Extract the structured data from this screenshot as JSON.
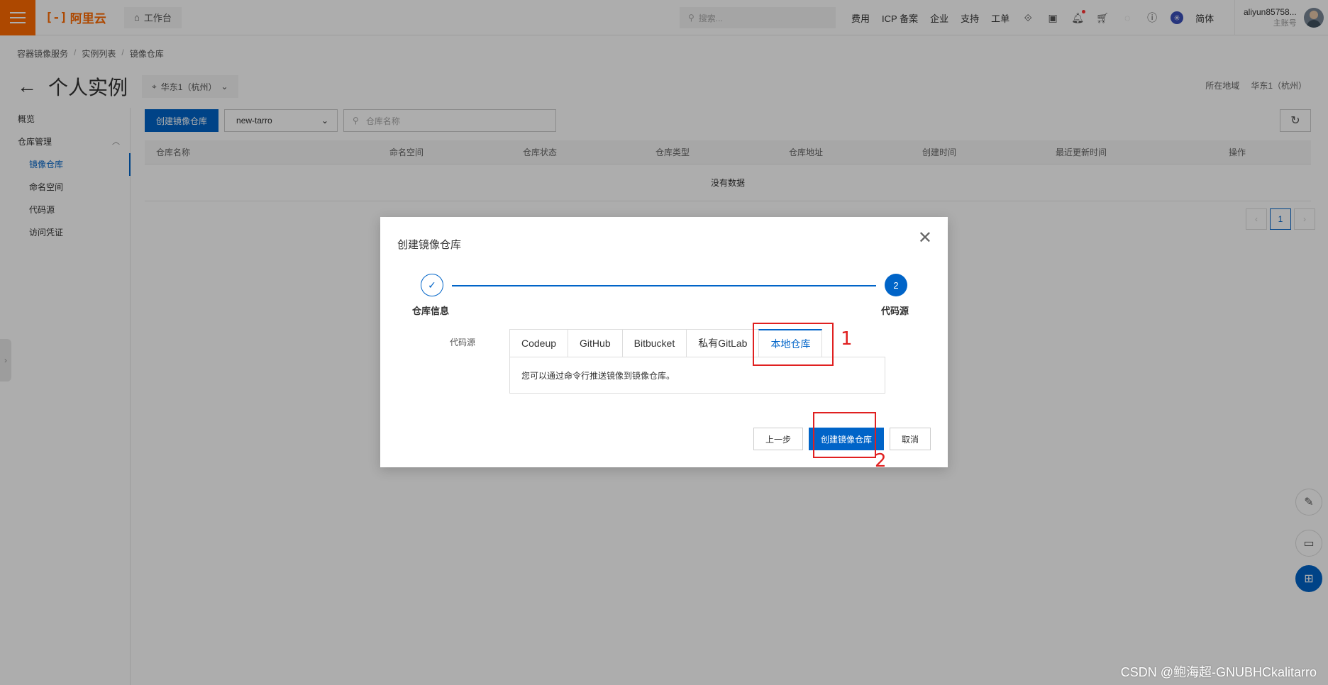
{
  "topbar": {
    "logo_text": "阿里云",
    "workbench": "工作台",
    "search_placeholder": "搜索...",
    "links": [
      "费用",
      "ICP 备案",
      "企业",
      "支持",
      "工单"
    ],
    "lang": "简体",
    "user_name": "aliyun85758...",
    "user_sub": "主账号"
  },
  "breadcrumb": [
    "容器镜像服务",
    "实例列表",
    "镜像仓库"
  ],
  "page": {
    "title": "个人实例",
    "region": "华东1（杭州）",
    "region_label": "所在地域",
    "region_value": "华东1（杭州）"
  },
  "sidebar": {
    "overview": "概览",
    "repo_mgmt": "仓库管理",
    "items": [
      "镜像仓库",
      "命名空间",
      "代码源",
      "访问凭证"
    ]
  },
  "toolbar": {
    "create_label": "创建镜像仓库",
    "namespace_value": "new-tarro",
    "search_placeholder": "仓库名称"
  },
  "table": {
    "headers": [
      "仓库名称",
      "命名空间",
      "仓库状态",
      "仓库类型",
      "仓库地址",
      "创建时间",
      "最近更新时间",
      "操作"
    ],
    "empty": "没有数据"
  },
  "pager": {
    "current": "1"
  },
  "dialog": {
    "title": "创建镜像仓库",
    "step1": "仓库信息",
    "step2_num": "2",
    "step2": "代码源",
    "source_label": "代码源",
    "tabs": [
      "Codeup",
      "GitHub",
      "Bitbucket",
      "私有GitLab",
      "本地仓库"
    ],
    "active_tab": 4,
    "panel_text": "您可以通过命令行推送镜像到镜像仓库。",
    "prev_label": "上一步",
    "create_label": "创建镜像仓库",
    "cancel_label": "取消"
  },
  "annotations": {
    "one": "1",
    "two": "2"
  },
  "watermark": "CSDN @鲍海超-GNUBHCkalitarro",
  "colors": {
    "accent": "#0064c8",
    "brand": "#ff6a00",
    "annotation": "#e02020"
  }
}
